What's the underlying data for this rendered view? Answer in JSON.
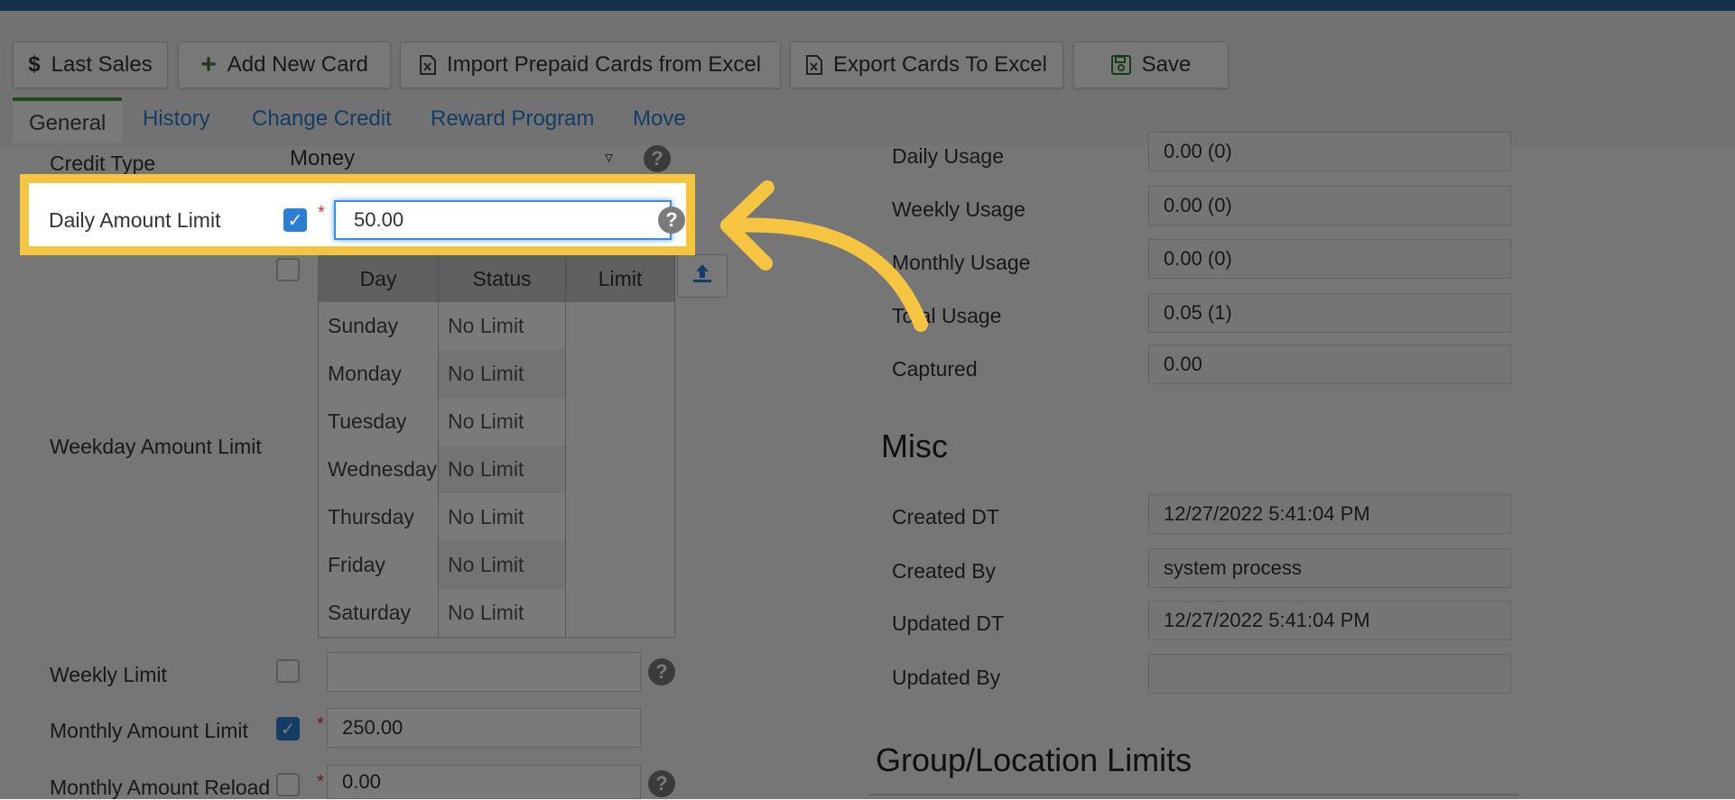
{
  "toolbar": {
    "last_sales": "Last Sales",
    "add_new_card": "Add New Card",
    "import_cards": "Import Prepaid Cards from Excel",
    "export_cards": "Export Cards To Excel",
    "save": "Save"
  },
  "tabs": [
    "General",
    "History",
    "Change Credit",
    "Reward Program",
    "Move"
  ],
  "form": {
    "credit_type_label": "Credit Type",
    "credit_type_value": "Money",
    "daily_amount_limit_label": "Daily Amount Limit",
    "daily_amount_limit_value": "50.00",
    "weekday_amount_limit_label": "Weekday Amount Limit",
    "weekday_table": {
      "headers": [
        "Day",
        "Status",
        "Limit"
      ],
      "rows": [
        {
          "day": "Sunday",
          "status": "No Limit",
          "limit": ""
        },
        {
          "day": "Monday",
          "status": "No Limit",
          "limit": ""
        },
        {
          "day": "Tuesday",
          "status": "No Limit",
          "limit": ""
        },
        {
          "day": "Wednesday",
          "status": "No Limit",
          "limit": ""
        },
        {
          "day": "Thursday",
          "status": "No Limit",
          "limit": ""
        },
        {
          "day": "Friday",
          "status": "No Limit",
          "limit": ""
        },
        {
          "day": "Saturday",
          "status": "No Limit",
          "limit": ""
        }
      ]
    },
    "weekly_limit_label": "Weekly Limit",
    "weekly_limit_value": "",
    "monthly_amount_limit_label": "Monthly Amount Limit",
    "monthly_amount_limit_value": "250.00",
    "monthly_amount_reload_label": "Monthly Amount Reload",
    "monthly_amount_reload_value": "0.00",
    "required_mark": "*",
    "help_glyph": "?",
    "check_glyph": "✓"
  },
  "usage": {
    "daily_usage_label": "Daily Usage",
    "daily_usage_value": "0.00 (0)",
    "weekly_usage_label": "Weekly Usage",
    "weekly_usage_value": "0.00 (0)",
    "monthly_usage_label": "Monthly Usage",
    "monthly_usage_value": "0.00 (0)",
    "total_usage_label": "Total Usage",
    "total_usage_value": "0.05 (1)",
    "captured_label": "Captured",
    "captured_value": "0.00"
  },
  "misc": {
    "title": "Misc",
    "created_dt_label": "Created DT",
    "created_dt_value": "12/27/2022 5:41:04 PM",
    "created_by_label": "Created By",
    "created_by_value": "system process",
    "updated_dt_label": "Updated DT",
    "updated_dt_value": "12/27/2022 5:41:04 PM",
    "updated_by_label": "Updated By",
    "updated_by_value": ""
  },
  "group_location_title": "Group/Location Limits",
  "colors": {
    "highlight": "#f5c542",
    "accent": "#2a7fd4",
    "topbar": "#2a6496"
  }
}
